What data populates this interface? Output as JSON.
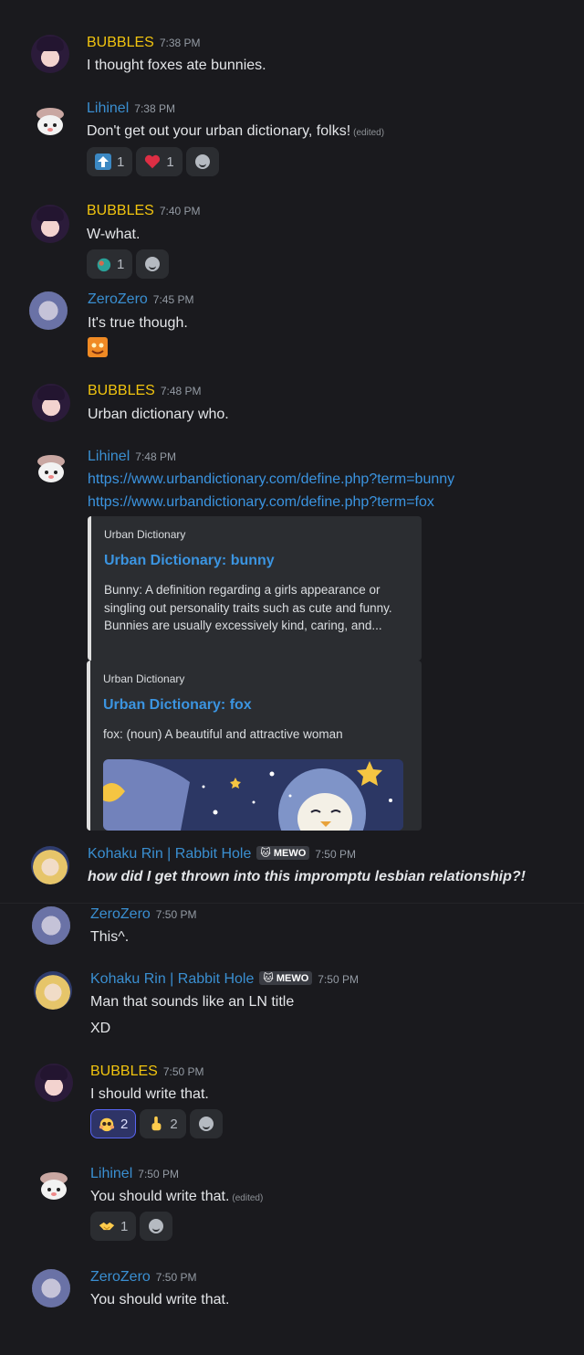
{
  "messages": [
    {
      "author": "BUBBLES",
      "time": "7:38 PM",
      "text": "I thought foxes ate bunnies."
    },
    {
      "author": "Lihinel",
      "time": "7:38 PM",
      "text": "Don't get out your urban dictionary, folks!",
      "edited": "(edited)",
      "reactions": [
        {
          "emoji": "up-arrow",
          "count": "1"
        },
        {
          "emoji": "heart",
          "count": "1"
        }
      ]
    },
    {
      "author": "BUBBLES",
      "time": "7:40 PM",
      "text": "W-what.",
      "reactions": [
        {
          "emoji": "sweat-smile",
          "count": "1"
        }
      ]
    },
    {
      "author": "ZeroZero",
      "time": "7:45 PM",
      "text": "It's true though."
    },
    {
      "author": "BUBBLES",
      "time": "7:48 PM",
      "text": "Urban dictionary who."
    },
    {
      "author": "Lihinel",
      "time": "7:48 PM",
      "links": [
        "https://www.urbandictionary.com/define.php?term=bunny",
        "https://www.urbandictionary.com/define.php?term=fox"
      ],
      "embeds": [
        {
          "provider": "Urban Dictionary",
          "title": "Urban Dictionary: bunny",
          "description": "Bunny: A definition regarding a girls appearance or singling out personality traits such as cute and funny. Bunnies are usually excessively kind, caring, and..."
        },
        {
          "provider": "Urban Dictionary",
          "title": "Urban Dictionary: fox",
          "description": "fox: (noun) A beautiful and attractive woman"
        }
      ]
    },
    {
      "author": "Kohaku Rin | Rabbit Hole",
      "tag": "MEWO",
      "time": "7:50 PM",
      "text": "how did I get thrown into this impromptu lesbian relationship?!"
    },
    {
      "author": "ZeroZero",
      "time": "7:50 PM",
      "text": "This^."
    },
    {
      "author": "Kohaku Rin | Rabbit Hole",
      "tag": "MEWO",
      "time": "7:50 PM",
      "text": "Man that sounds like an LN title",
      "text2": "XD"
    },
    {
      "author": "BUBBLES",
      "time": "7:50 PM",
      "text": "I should write that.",
      "reactions": [
        {
          "emoji": "pleading-face",
          "count": "2"
        },
        {
          "emoji": "pointing-up",
          "count": "2"
        }
      ]
    },
    {
      "author": "Lihinel",
      "time": "7:50 PM",
      "text": "You should write that.",
      "edited": "(edited)",
      "reactions": [
        {
          "emoji": "handshake",
          "count": "1"
        }
      ]
    },
    {
      "author": "ZeroZero",
      "time": "7:50 PM",
      "text": "You should write that."
    }
  ],
  "colors": {
    "bubbles": "#f1c40f",
    "member": "#3a8fd1",
    "link": "#3b94e0",
    "background": "#1a1a1e"
  }
}
